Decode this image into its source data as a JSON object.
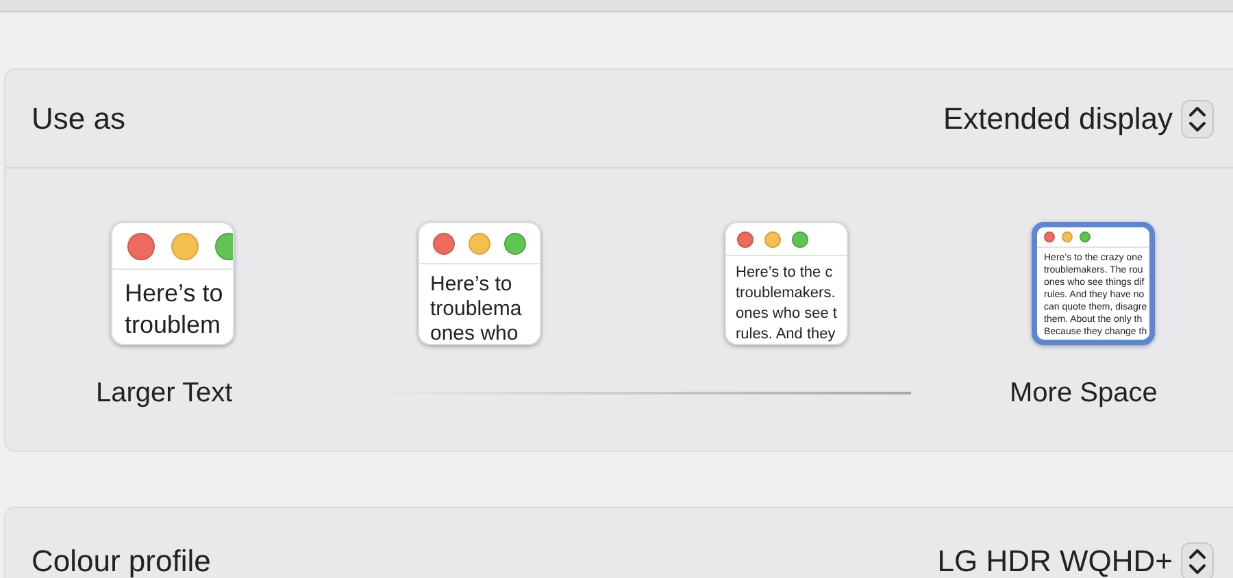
{
  "use_as": {
    "label": "Use as",
    "value": "Extended display"
  },
  "scale_options": [
    {
      "lines": [
        "Here’s to",
        "troublem"
      ],
      "label": "Larger Text",
      "selected": false
    },
    {
      "lines": [
        "Here’s to",
        "troublema",
        "ones who"
      ],
      "selected": false
    },
    {
      "lines": [
        "Here’s to the c",
        "troublemakers.",
        "ones who see t",
        "rules. And they"
      ],
      "selected": false
    },
    {
      "lines": [
        "Here’s to the crazy one",
        "troublemakers. The rou",
        "ones who see things dif",
        "rules. And they have no",
        "can quote them, disagre",
        "them. About the only th",
        "Because they change th"
      ],
      "label": "More Space",
      "selected": true
    }
  ],
  "colour_profile": {
    "label": "Colour profile",
    "value": "LG HDR WQHD+"
  }
}
